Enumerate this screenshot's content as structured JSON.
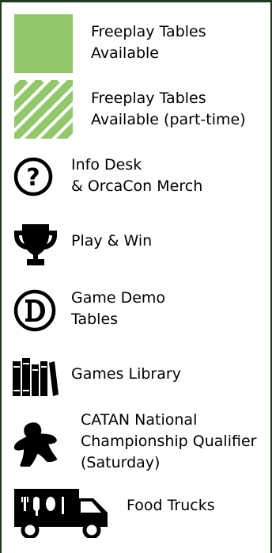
{
  "legend": {
    "swatch_color": "#92c86a",
    "items": [
      {
        "id": "freeplay",
        "icon": "solid-green-swatch",
        "lines": [
          "Freeplay Tables",
          "Available"
        ]
      },
      {
        "id": "freeplay-part-time",
        "icon": "striped-green-swatch",
        "lines": [
          "Freeplay Tables",
          "Available (part-time)"
        ]
      },
      {
        "id": "info-desk",
        "icon": "question-circle-icon",
        "lines": [
          "Info Desk",
          "& OrcaCon Merch"
        ]
      },
      {
        "id": "play-win",
        "icon": "trophy-icon",
        "lines": [
          "Play & Win"
        ]
      },
      {
        "id": "game-demo",
        "icon": "letter-d-circle-icon",
        "lines": [
          "Game Demo",
          "Tables"
        ]
      },
      {
        "id": "games-library",
        "icon": "books-icon",
        "lines": [
          "Games Library"
        ]
      },
      {
        "id": "catan",
        "icon": "meeple-icon",
        "lines": [
          "CATAN National",
          "Championship Qualifier",
          "(Saturday)"
        ]
      },
      {
        "id": "food-trucks",
        "icon": "food-truck-icon",
        "lines": [
          "Food Trucks"
        ]
      }
    ]
  }
}
